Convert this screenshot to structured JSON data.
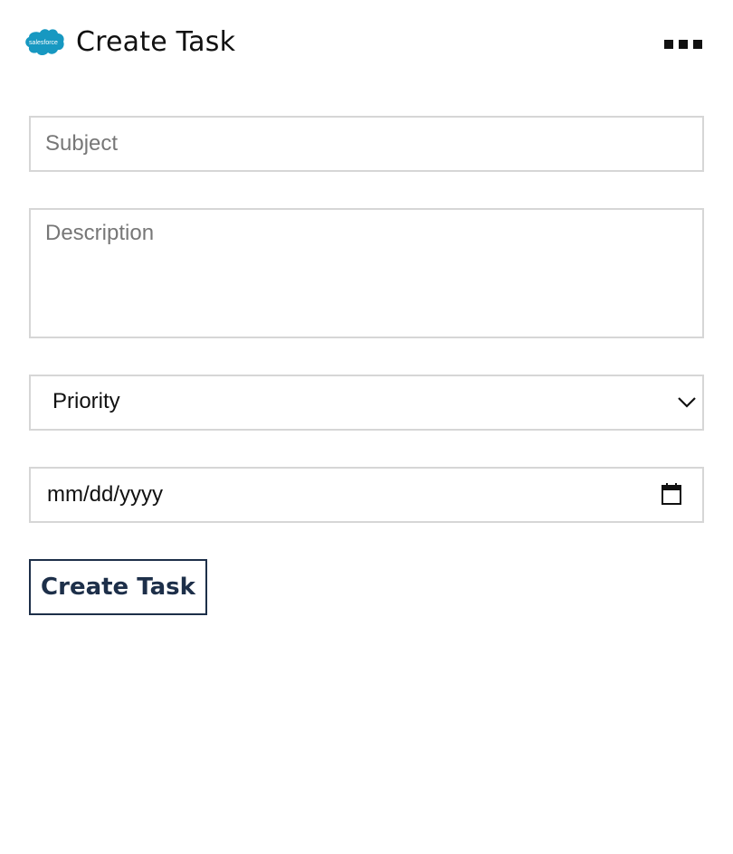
{
  "header": {
    "logo_text": "salesforce",
    "title": "Create Task",
    "more_icon": "ellipsis-menu-icon"
  },
  "form": {
    "subject": {
      "value": "",
      "placeholder": "Subject"
    },
    "description": {
      "value": "",
      "placeholder": "Description"
    },
    "priority": {
      "selected": "Priority",
      "icon": "chevron-down-icon"
    },
    "due_date": {
      "value": "mm/dd/yyyy",
      "icon": "calendar-icon"
    },
    "submit_label": "Create Task"
  },
  "colors": {
    "brand": "#1798c1",
    "button_text": "#1d2f49",
    "border": "#d6d6d6"
  }
}
